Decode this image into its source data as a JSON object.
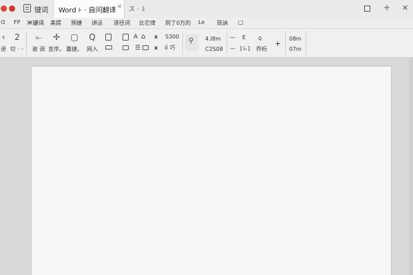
{
  "titlebar": {
    "left_tab": "键词",
    "active_tab": "Word ⊦ · 自问翻译",
    "tab_close": "×",
    "extra": "ス · ⇩"
  },
  "menu": {
    "items": [
      "Ɑ",
      "FP",
      "Ж键词",
      "美提",
      "预捷",
      "讲话",
      "遂径词",
      "比它律",
      "则了0万的",
      "Lɐ",
      "现讷",
      "□"
    ]
  },
  "ribbon": {
    "nav": [
      {
        "icon": "‹",
        "label": "退"
      },
      {
        "icon": "2",
        "label": "切 · ··"
      }
    ],
    "tools": [
      {
        "icon": "⟜",
        "label": "谢 调"
      },
      {
        "icon": "✢",
        "label": "变序。"
      },
      {
        "icon": "▢",
        "label": "囊捷。"
      },
      {
        "icon": "Q",
        "label": "网入"
      }
    ],
    "small_icons": [
      "A",
      "x",
      "x",
      "ő"
    ],
    "s_value": "S300",
    "s_value2": "ő 巧",
    "paint_label": "",
    "dim_top": "4.I8m",
    "dim_bottom": "C2S08",
    "mid": [
      "—",
      "E",
      "ꞯ",
      "—",
      "⟦∟⟧",
      "乔桁"
    ],
    "plus": "+",
    "right_top": "08m",
    "right_bottom": "07m"
  }
}
